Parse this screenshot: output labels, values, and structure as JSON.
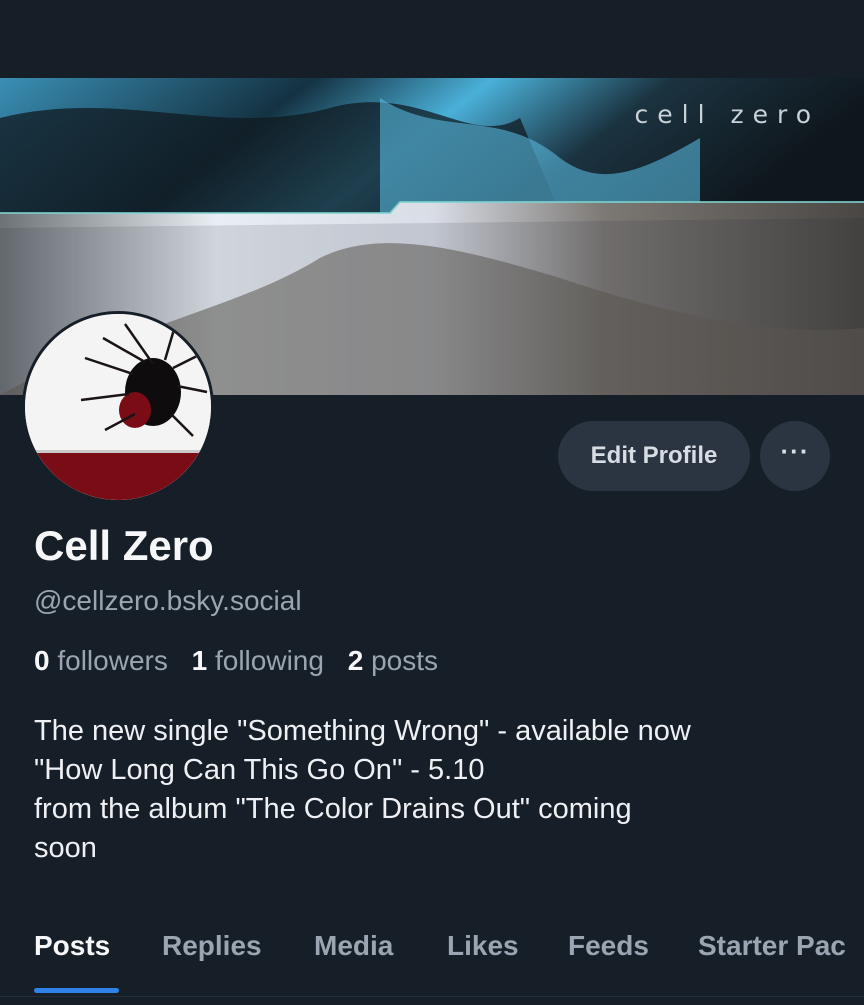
{
  "banner": {
    "text": "cell zero"
  },
  "profile": {
    "display_name": "Cell Zero",
    "handle": "@cellzero.bsky.social",
    "followers_count": "0",
    "followers_label": "followers",
    "following_count": "1",
    "following_label": "following",
    "posts_count": "2",
    "posts_label": "posts",
    "bio_lines": [
      "The new single \"Something Wrong\" - available now",
      "\"How Long Can This Go On\" - 5.10",
      "from the album \"The Color Drains Out\" coming",
      "soon"
    ]
  },
  "actions": {
    "edit_label": "Edit Profile",
    "more_label": "···"
  },
  "tabs": [
    {
      "label": "Posts",
      "active": true
    },
    {
      "label": "Replies",
      "active": false
    },
    {
      "label": "Media",
      "active": false
    },
    {
      "label": "Likes",
      "active": false
    },
    {
      "label": "Feeds",
      "active": false
    },
    {
      "label": "Starter Pac",
      "active": false
    }
  ],
  "colors": {
    "background": "#161e27",
    "button_bg": "#2b3542",
    "accent": "#2f83e8",
    "muted_text": "#9aa5b1"
  }
}
